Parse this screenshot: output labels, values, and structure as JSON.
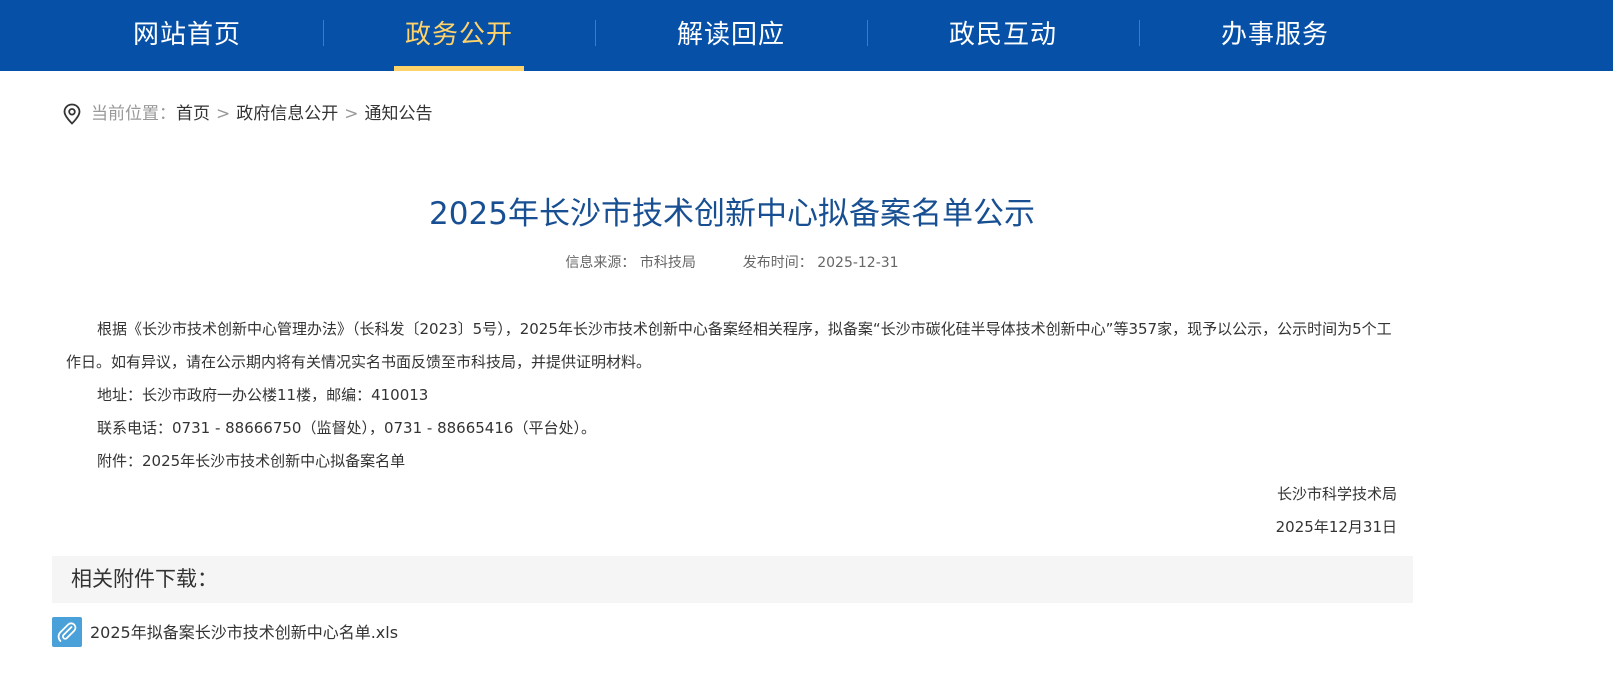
{
  "nav": {
    "items": [
      {
        "label": "网站首页",
        "active": false
      },
      {
        "label": "政务公开",
        "active": true
      },
      {
        "label": "解读回应",
        "active": false
      },
      {
        "label": "政民互动",
        "active": false
      },
      {
        "label": "办事服务",
        "active": false
      }
    ],
    "active_color": "#ffd36a",
    "bg_color": "#0650a8"
  },
  "breadcrumb": {
    "icon": "location-pin-icon",
    "prefix": "当前位置：",
    "items": [
      "首页",
      "政府信息公开",
      "通知公告"
    ],
    "separator": ">"
  },
  "article": {
    "title": "2025年长沙市技术创新中心拟备案名单公示",
    "source_label": "信息来源：",
    "source": "市科技局",
    "date_label": "发布时间：",
    "date": "2025-12-31",
    "paragraphs": [
      "根据《长沙市技术创新中心管理办法》（长科发〔2023〕5号），2025年长沙市技术创新中心备案经相关程序，拟备案“长沙市碳化硅半导体技术创新中心”等357家，现予以公示，公示时间为5个工作日。如有异议，请在公示期内将有关情况实名书面反馈至市科技局，并提供证明材料。",
      "地址：长沙市政府一办公楼11楼，邮编：410013",
      "联系电话：0731 - 88666750（监督处），0731 - 88665416（平台处）。",
      "附件：2025年长沙市技术创新中心拟备案名单"
    ],
    "signature": "长沙市科学技术局",
    "signature_date": "2025年12月31日"
  },
  "attachments": {
    "heading": "相关附件下载：",
    "files": [
      {
        "name": "2025年拟备案长沙市技术创新中心名单.xls",
        "icon": "paperclip-icon"
      }
    ]
  }
}
